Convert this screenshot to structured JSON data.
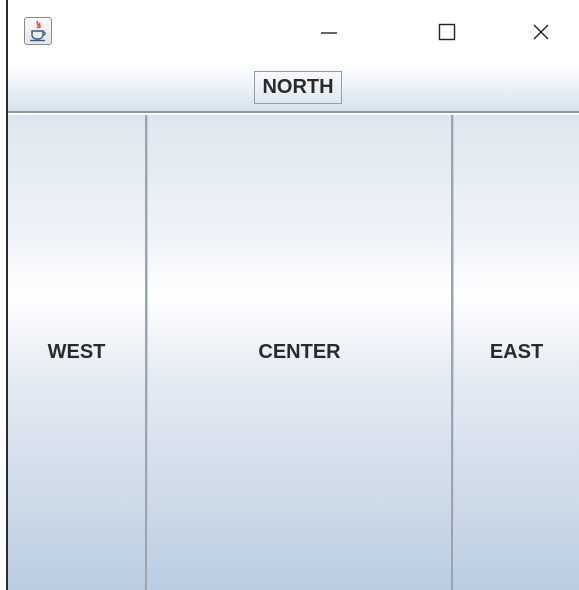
{
  "window": {
    "controls": {
      "minimize_icon": "minimize-icon",
      "maximize_icon": "maximize-icon",
      "close_icon": "close-icon"
    }
  },
  "regions": {
    "north": "NORTH",
    "west": "WEST",
    "center": "CENTER",
    "east": "EAST"
  },
  "colors": {
    "panel_top": "#ffffff",
    "panel_bottom": "#b9cde2",
    "border": "#8f9fb2",
    "text": "#2a2a2a"
  }
}
